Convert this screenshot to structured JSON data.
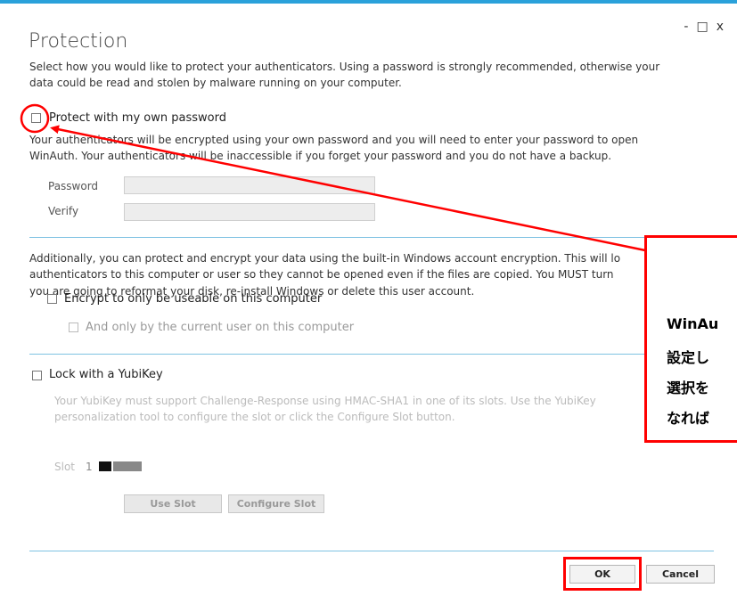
{
  "window": {
    "minimize": "-",
    "maximize": "□",
    "close": "x"
  },
  "title": "Protection",
  "intro": {
    "line1": "Select how you would like to protect your authenticators. Using a password is strongly recommended, otherwise your",
    "line2": "data could be read and stolen by malware running on your computer."
  },
  "password_option": {
    "label": "Protect with my own password",
    "desc_line1": "Your authenticators will be encrypted using your own password and you will need to enter your password to open",
    "desc_line2": "WinAuth. Your authenticators will be inaccessible if you forget your password and you do not have a backup.",
    "password_label": "Password",
    "verify_label": "Verify",
    "password_value": "",
    "verify_value": ""
  },
  "encrypt_section": {
    "line1": "Additionally, you can protect and encrypt your data using the built-in Windows account encryption. This will lo",
    "line2": "authenticators to this computer or user so they cannot be opened even if the files are copied. You MUST turn",
    "line3": "you are going to reformat your disk, re-install Windows or delete this user account.",
    "machine_label": "Encrypt to only be useable on this computer",
    "user_label": "And only by the current user on this computer"
  },
  "yubikey": {
    "label": "Lock with a YubiKey",
    "desc_line1": "Your YubiKey must support Challenge-Response using HMAC-SHA1 in one of its slots. Use the YubiKey",
    "desc_line2": "personalization tool to configure the slot or click the Configure Slot button.",
    "slot_label": "Slot",
    "slot_value": "1",
    "use_slot": "Use Slot",
    "configure_slot": "Configure Slot"
  },
  "buttons": {
    "ok": "OK",
    "cancel": "Cancel"
  },
  "annotation": {
    "line1": "WinAu",
    "line2": "設定し",
    "line3": "選択を",
    "line4": "なれば"
  },
  "colors": {
    "accent": "#2aa1da",
    "annotation_red": "#ff0000"
  }
}
